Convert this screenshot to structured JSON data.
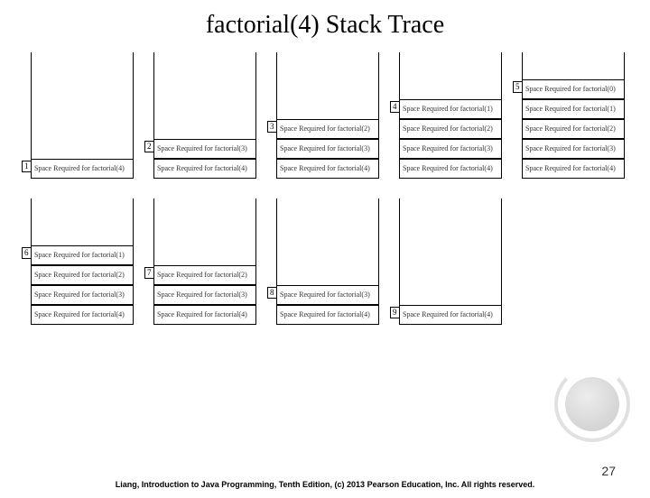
{
  "title": "factorial(4) Stack Trace",
  "frame_label_prefix": "Space Required for factorial(",
  "frame_label_suffix": ")",
  "top_row": [
    {
      "step": "1",
      "frames": [
        4
      ]
    },
    {
      "step": "2",
      "frames": [
        3,
        4
      ]
    },
    {
      "step": "3",
      "frames": [
        2,
        3,
        4
      ]
    },
    {
      "step": "4",
      "frames": [
        1,
        2,
        3,
        4
      ]
    },
    {
      "step": "5",
      "frames": [
        0,
        1,
        2,
        3,
        4
      ]
    }
  ],
  "bottom_row": [
    {
      "step": "6",
      "frames": [
        1,
        2,
        3,
        4
      ]
    },
    {
      "step": "7",
      "frames": [
        2,
        3,
        4
      ]
    },
    {
      "step": "8",
      "frames": [
        3,
        4
      ]
    },
    {
      "step": "9",
      "frames": [
        4
      ]
    }
  ],
  "footer": "Liang, Introduction to Java Programming, Tenth Edition, (c) 2013 Pearson Education, Inc. All rights reserved.",
  "page_number": "27"
}
